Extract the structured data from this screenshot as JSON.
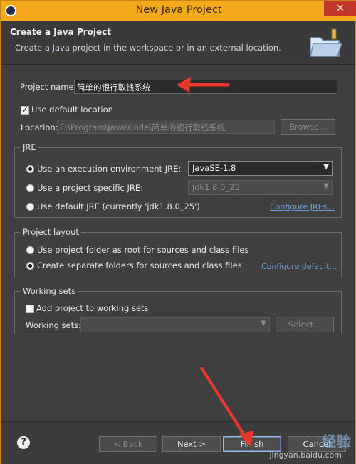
{
  "window": {
    "title": "New Java Project",
    "close_label": "✕"
  },
  "banner": {
    "title": "Create a Java Project",
    "description": "Create a Java project in the workspace or in an external location."
  },
  "project": {
    "name_label": "Project name:",
    "name_value": "简单的银行取钱系统",
    "use_default_location_label": "Use default location",
    "use_default_location_checked": true,
    "location_label": "Location:",
    "location_value": "E:\\Program\\Java\\Code\\简单的银行取钱系统",
    "browse_label": "Browse..."
  },
  "jre": {
    "group_title": "JRE",
    "option_env_label": "Use an execution environment JRE:",
    "option_env_value": "JavaSE-1.8",
    "option_specific_label": "Use a project specific JRE:",
    "option_specific_value": "jdk1.8.0_25",
    "option_default_label": "Use default JRE (currently 'jdk1.8.0_25')",
    "configure_link": "Configure JREs..."
  },
  "layout": {
    "group_title": "Project layout",
    "option_root_label": "Use project folder as root for sources and class files",
    "option_separate_label": "Create separate folders for sources and class files",
    "configure_link": "Configure default..."
  },
  "working_sets": {
    "group_title": "Working sets",
    "add_label": "Add project to working sets",
    "sets_label": "Working sets:",
    "select_label": "Select..."
  },
  "footer": {
    "help_label": "?",
    "back_label": "< Back",
    "next_label": "Next >",
    "finish_label": "Finish",
    "cancel_label": "Cancel"
  },
  "watermark": {
    "brand": "经验",
    "url": "jingyan.baidu.com"
  },
  "colors": {
    "titlebar": "#f4a81c",
    "background": "#3f3f3f",
    "arrow": "#e8382b",
    "link": "#6f9cdc"
  }
}
